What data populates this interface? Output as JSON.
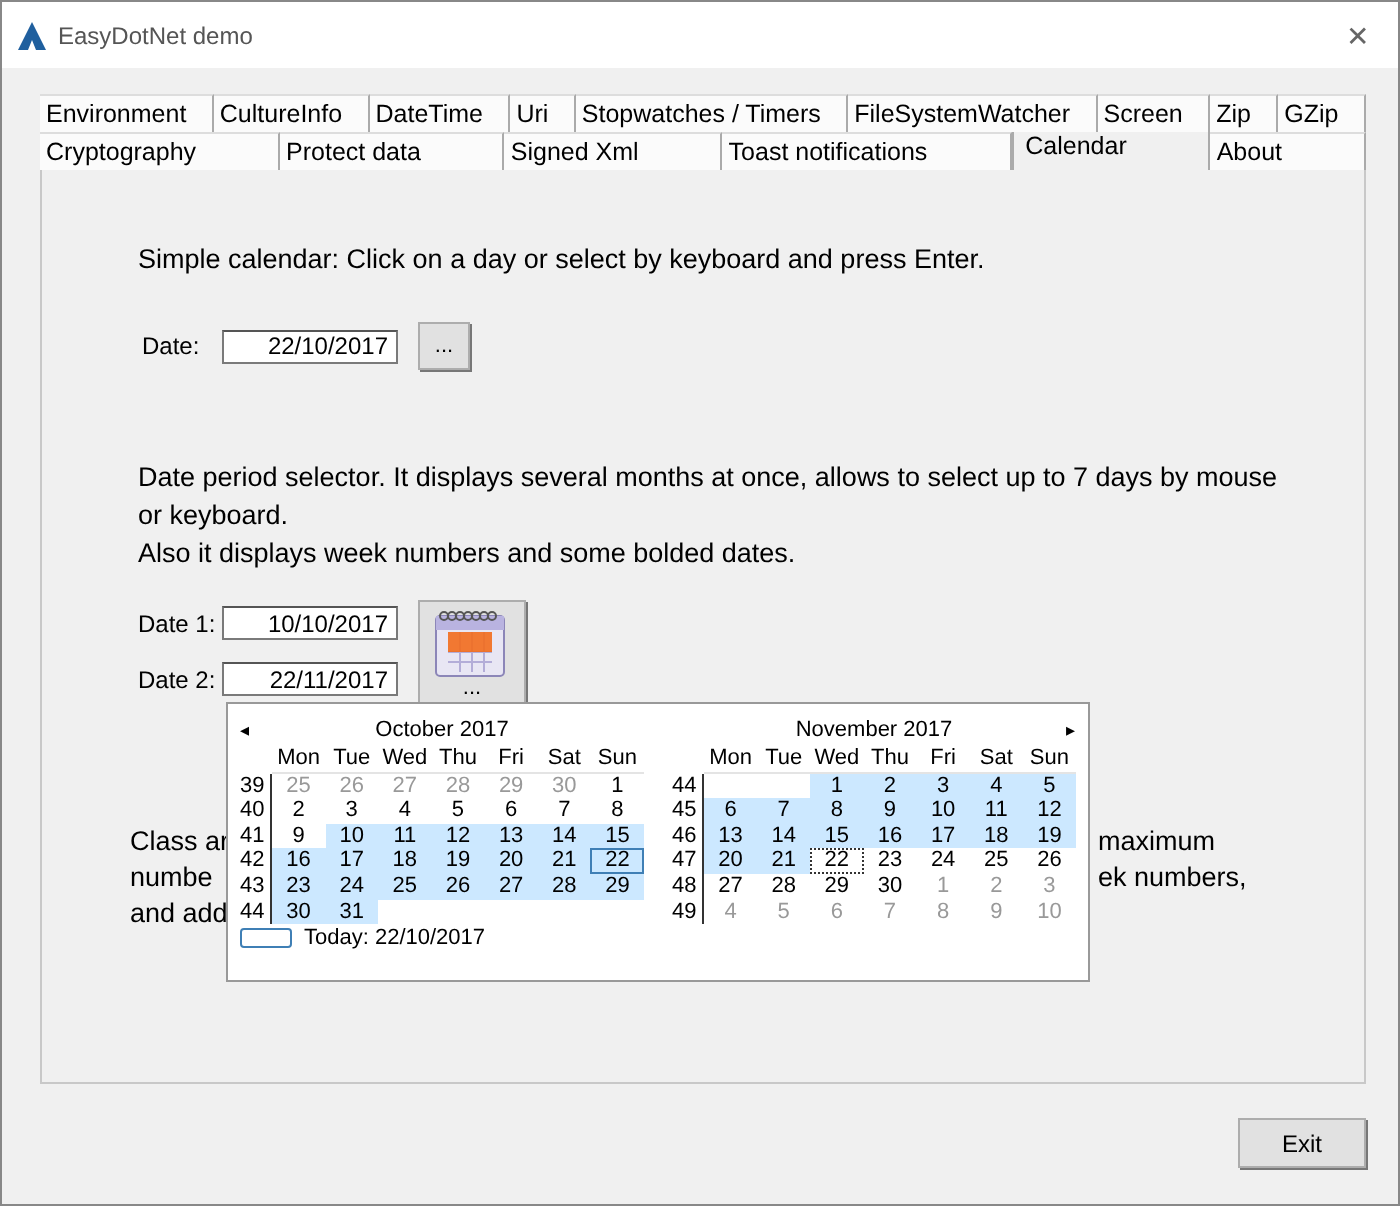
{
  "window": {
    "title": "EasyDotNet demo",
    "close": "✕"
  },
  "tab_rows": [
    [
      {
        "label": "Environment",
        "selected": false
      },
      {
        "label": "CultureInfo",
        "selected": false
      },
      {
        "label": "DateTime",
        "selected": false
      },
      {
        "label": "Uri",
        "selected": false
      },
      {
        "label": "Stopwatches / Timers",
        "selected": false
      },
      {
        "label": "FileSystemWatcher",
        "selected": false
      },
      {
        "label": "Screen",
        "selected": false
      },
      {
        "label": "Zip",
        "selected": false
      },
      {
        "label": "GZip",
        "selected": false
      }
    ],
    [
      {
        "label": "Cryptography",
        "selected": false
      },
      {
        "label": "Protect data",
        "selected": false
      },
      {
        "label": "Signed Xml",
        "selected": false
      },
      {
        "label": "Toast notifications",
        "selected": false
      },
      {
        "label": "Calendar",
        "selected": true
      },
      {
        "label": "About",
        "selected": false
      }
    ]
  ],
  "simple": {
    "text": "Simple calendar: Click on a day or select by keyboard and press Enter.",
    "label": "Date:",
    "value": "22/10/2017",
    "button": "..."
  },
  "period": {
    "text": [
      "Date period selector. It displays several months at once, allows to select up to 7 days by mouse or keyboard.",
      "Also it displays week numbers and some bolded dates."
    ],
    "date1": {
      "label": "Date 1:",
      "value": "10/10/2017"
    },
    "date2": {
      "label": "Date 2:",
      "value": "22/11/2017"
    },
    "button": "..."
  },
  "class_text": {
    "left": [
      "Class ar",
      "numbe",
      "and add"
    ],
    "right": [
      "maximum",
      "ek numbers,"
    ]
  },
  "popup": {
    "prev": "◂",
    "next": "▸",
    "today": "Today: 22/10/2017",
    "months": [
      {
        "title": "October 2017",
        "weekdays": [
          "Mon",
          "Tue",
          "Wed",
          "Thu",
          "Fri",
          "Sat",
          "Sun"
        ],
        "weeks": [
          {
            "number": "39",
            "days": [
              {
                "day": "25",
                "muted": true,
                "selected": false
              },
              {
                "day": "26",
                "muted": true,
                "selected": false
              },
              {
                "day": "27",
                "muted": true,
                "selected": false
              },
              {
                "day": "28",
                "muted": true,
                "selected": false
              },
              {
                "day": "29",
                "muted": true,
                "selected": false
              },
              {
                "day": "30",
                "muted": true,
                "selected": false
              },
              {
                "day": "1",
                "muted": false,
                "selected": false
              }
            ]
          },
          {
            "number": "40",
            "days": [
              {
                "day": "2",
                "muted": false,
                "selected": false
              },
              {
                "day": "3",
                "muted": false,
                "selected": false
              },
              {
                "day": "4",
                "muted": false,
                "selected": false
              },
              {
                "day": "5",
                "muted": false,
                "selected": false
              },
              {
                "day": "6",
                "muted": false,
                "selected": false
              },
              {
                "day": "7",
                "muted": false,
                "selected": false
              },
              {
                "day": "8",
                "muted": false,
                "selected": false
              }
            ]
          },
          {
            "number": "41",
            "days": [
              {
                "day": "9",
                "muted": false,
                "selected": false
              },
              {
                "day": "10",
                "muted": false,
                "selected": true
              },
              {
                "day": "11",
                "muted": false,
                "selected": true
              },
              {
                "day": "12",
                "muted": false,
                "selected": true
              },
              {
                "day": "13",
                "muted": false,
                "selected": true
              },
              {
                "day": "14",
                "muted": false,
                "selected": true
              },
              {
                "day": "15",
                "muted": false,
                "selected": true
              }
            ]
          },
          {
            "number": "42",
            "days": [
              {
                "day": "16",
                "muted": false,
                "selected": true
              },
              {
                "day": "17",
                "muted": false,
                "selected": true
              },
              {
                "day": "18",
                "muted": false,
                "selected": true
              },
              {
                "day": "19",
                "muted": false,
                "selected": true
              },
              {
                "day": "20",
                "muted": false,
                "selected": true
              },
              {
                "day": "21",
                "muted": false,
                "selected": true
              },
              {
                "day": "22",
                "muted": false,
                "selected": true,
                "today": true
              }
            ]
          },
          {
            "number": "43",
            "days": [
              {
                "day": "23",
                "muted": false,
                "selected": true
              },
              {
                "day": "24",
                "muted": false,
                "selected": true
              },
              {
                "day": "25",
                "muted": false,
                "selected": true
              },
              {
                "day": "26",
                "muted": false,
                "selected": true
              },
              {
                "day": "27",
                "muted": false,
                "selected": true
              },
              {
                "day": "28",
                "muted": false,
                "selected": true
              },
              {
                "day": "29",
                "muted": false,
                "selected": true
              }
            ]
          },
          {
            "number": "44",
            "days": [
              {
                "day": "30",
                "muted": false,
                "selected": true
              },
              {
                "day": "31",
                "muted": false,
                "selected": true
              }
            ]
          }
        ]
      },
      {
        "title": "November 2017",
        "weekdays": [
          "Mon",
          "Tue",
          "Wed",
          "Thu",
          "Fri",
          "Sat",
          "Sun"
        ],
        "weeks": [
          {
            "number": "44",
            "days": [
              {
                "day": "1",
                "muted": false,
                "selected": true
              },
              {
                "day": "2",
                "muted": false,
                "selected": true
              },
              {
                "day": "3",
                "muted": false,
                "selected": true
              },
              {
                "day": "4",
                "muted": false,
                "selected": true
              },
              {
                "day": "5",
                "muted": false,
                "selected": true
              }
            ]
          },
          {
            "number": "45",
            "days": [
              {
                "day": "6",
                "muted": false,
                "selected": true
              },
              {
                "day": "7",
                "muted": false,
                "selected": true
              },
              {
                "day": "8",
                "muted": false,
                "selected": true
              },
              {
                "day": "9",
                "muted": false,
                "selected": true
              },
              {
                "day": "10",
                "muted": false,
                "selected": true
              },
              {
                "day": "11",
                "muted": false,
                "selected": true
              },
              {
                "day": "12",
                "muted": false,
                "selected": true
              }
            ]
          },
          {
            "number": "46",
            "days": [
              {
                "day": "13",
                "muted": false,
                "selected": true
              },
              {
                "day": "14",
                "muted": false,
                "selected": true
              },
              {
                "day": "15",
                "muted": false,
                "selected": true
              },
              {
                "day": "16",
                "muted": false,
                "selected": true
              },
              {
                "day": "17",
                "muted": false,
                "selected": true
              },
              {
                "day": "18",
                "muted": false,
                "selected": true
              },
              {
                "day": "19",
                "muted": false,
                "selected": true
              }
            ]
          },
          {
            "number": "47",
            "days": [
              {
                "day": "20",
                "muted": false,
                "selected": true
              },
              {
                "day": "21",
                "muted": false,
                "selected": true
              },
              {
                "day": "22",
                "muted": false,
                "selected": false,
                "focused": true
              },
              {
                "day": "23",
                "muted": false,
                "selected": false
              },
              {
                "day": "24",
                "muted": false,
                "selected": false
              },
              {
                "day": "25",
                "muted": false,
                "selected": false
              },
              {
                "day": "26",
                "muted": false,
                "selected": false
              }
            ]
          },
          {
            "number": "48",
            "days": [
              {
                "day": "27",
                "muted": false,
                "selected": false
              },
              {
                "day": "28",
                "muted": false,
                "selected": false
              },
              {
                "day": "29",
                "muted": false,
                "selected": false
              },
              {
                "day": "30",
                "muted": false,
                "selected": false
              },
              {
                "day": "1",
                "muted": true,
                "selected": false
              },
              {
                "day": "2",
                "muted": true,
                "selected": false
              },
              {
                "day": "3",
                "muted": true,
                "selected": false
              }
            ]
          },
          {
            "number": "49",
            "days": [
              {
                "day": "4",
                "muted": true,
                "selected": false
              },
              {
                "day": "5",
                "muted": true,
                "selected": false
              },
              {
                "day": "6",
                "muted": true,
                "selected": false
              },
              {
                "day": "7",
                "muted": true,
                "selected": false
              },
              {
                "day": "8",
                "muted": true,
                "selected": false
              },
              {
                "day": "9",
                "muted": true,
                "selected": false
              },
              {
                "day": "10",
                "muted": true,
                "selected": false
              }
            ]
          }
        ]
      }
    ]
  },
  "exit": "Exit"
}
